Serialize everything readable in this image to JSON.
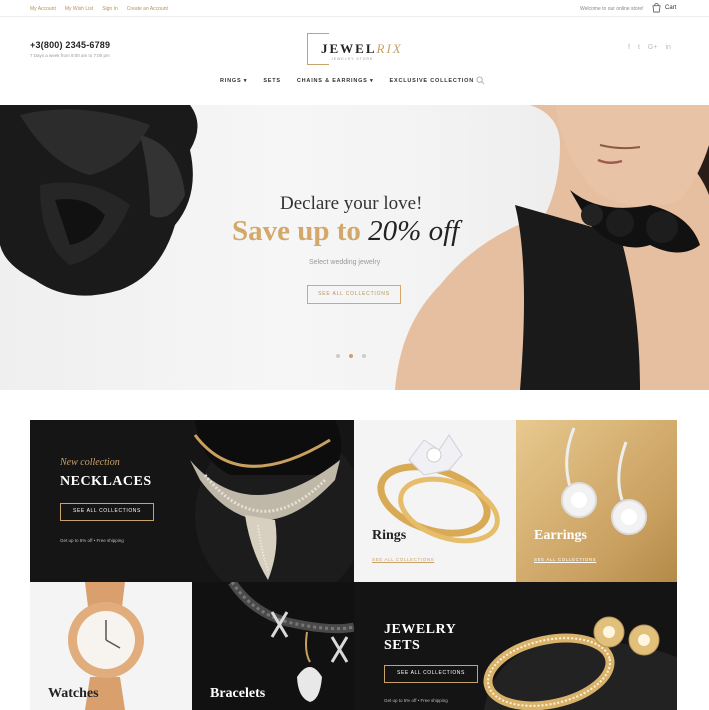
{
  "topbar": {
    "links": [
      "My Account",
      "My Wish List",
      "Sign In",
      "Create an Account"
    ],
    "welcome": "Welcome to our online store!",
    "cart_label": "Cart"
  },
  "header": {
    "phone": "+3(800) 2345-6789",
    "hours": "7 Days a week from 9:00 am to 7:00 pm",
    "logo_main": "JEWEL",
    "logo_accent": "RIX",
    "logo_sub": "JEWELRY STORE",
    "social": [
      "f",
      "t",
      "G+",
      "in"
    ]
  },
  "nav": {
    "items": [
      "RINGS ▾",
      "SETS",
      "CHAINS & EARRINGS ▾",
      "EXCLUSIVE COLLECTION"
    ]
  },
  "hero": {
    "title": "Declare your love!",
    "sale_gold": "Save up to ",
    "sale_dark": "20% off",
    "subtitle": "Select wedding jewelry",
    "button": "SEE ALL COLLECTIONS",
    "slide_count": 3,
    "active_slide": 2
  },
  "tiles": {
    "necklaces": {
      "kicker": "New collection",
      "title": "NECKLACES",
      "button": "SEE ALL COLLECTIONS",
      "note": "Get up to 5% off • Free shipping"
    },
    "rings": {
      "title": "Rings",
      "link": "SEE ALL COLLECTIONS"
    },
    "earrings": {
      "title": "Earrings",
      "link": "SEE ALL COLLECTIONS"
    },
    "watches": {
      "title": "Watches"
    },
    "bracelets": {
      "title": "Bracelets"
    },
    "sets": {
      "title_line1": "JEWELRY",
      "title_line2": "SETS",
      "button": "SEE ALL COLLECTIONS",
      "note": "Get up to 5% off • Free shipping"
    }
  },
  "colors": {
    "gold": "#c8a26a",
    "dark": "#111111"
  }
}
